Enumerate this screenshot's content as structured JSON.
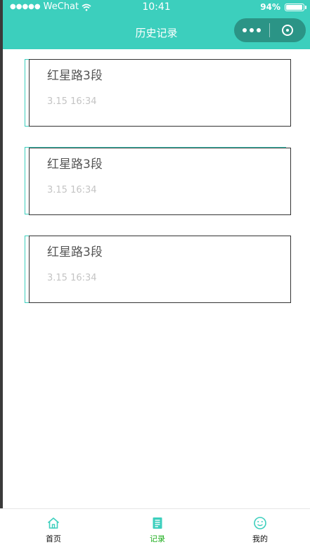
{
  "status_bar": {
    "carrier": "WeChat",
    "time": "10:41",
    "battery": "94%",
    "battery_level": 0.94
  },
  "nav": {
    "title": "历史记录"
  },
  "records": [
    {
      "place": "红星路3段",
      "time": "3.15 16:34"
    },
    {
      "place": "红星路3段",
      "time": "3.15 16:34"
    },
    {
      "place": "红星路3段",
      "time": "3.15 16:34"
    }
  ],
  "tabbar": {
    "items": [
      {
        "label": "首页",
        "icon": "home-icon"
      },
      {
        "label": "记录",
        "icon": "document-icon"
      },
      {
        "label": "我的",
        "icon": "smiley-icon"
      }
    ],
    "active_color": "#1aad19",
    "accent": "#3ccfbd"
  }
}
